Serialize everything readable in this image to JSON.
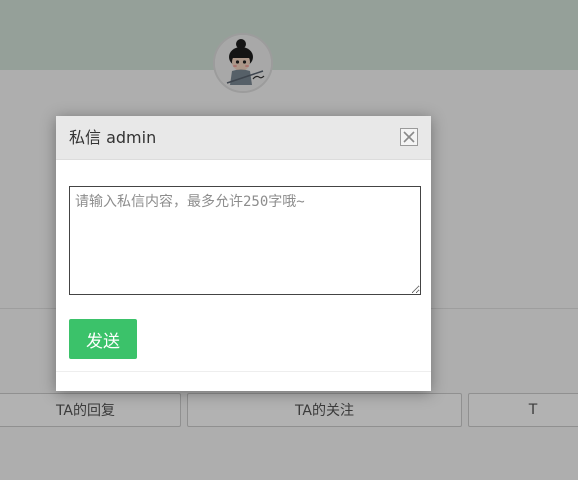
{
  "dialog": {
    "title": "私信 admin",
    "message_placeholder": "请输入私信内容，最多允许250字哦~",
    "message_value": "",
    "send_label": "发送",
    "close_icon": "close-icon"
  },
  "profile": {
    "avatar_icon": "avatar-cartoon-girl"
  },
  "tabs": [
    {
      "label": "TA的回复"
    },
    {
      "label": "TA的关注"
    },
    {
      "label": "T"
    }
  ],
  "colors": {
    "accent_green": "#3bc26a",
    "banner": "#d6e6dc",
    "overlay": "rgba(0,0,0,0.3)",
    "dialog_header": "#e8e8e8"
  }
}
